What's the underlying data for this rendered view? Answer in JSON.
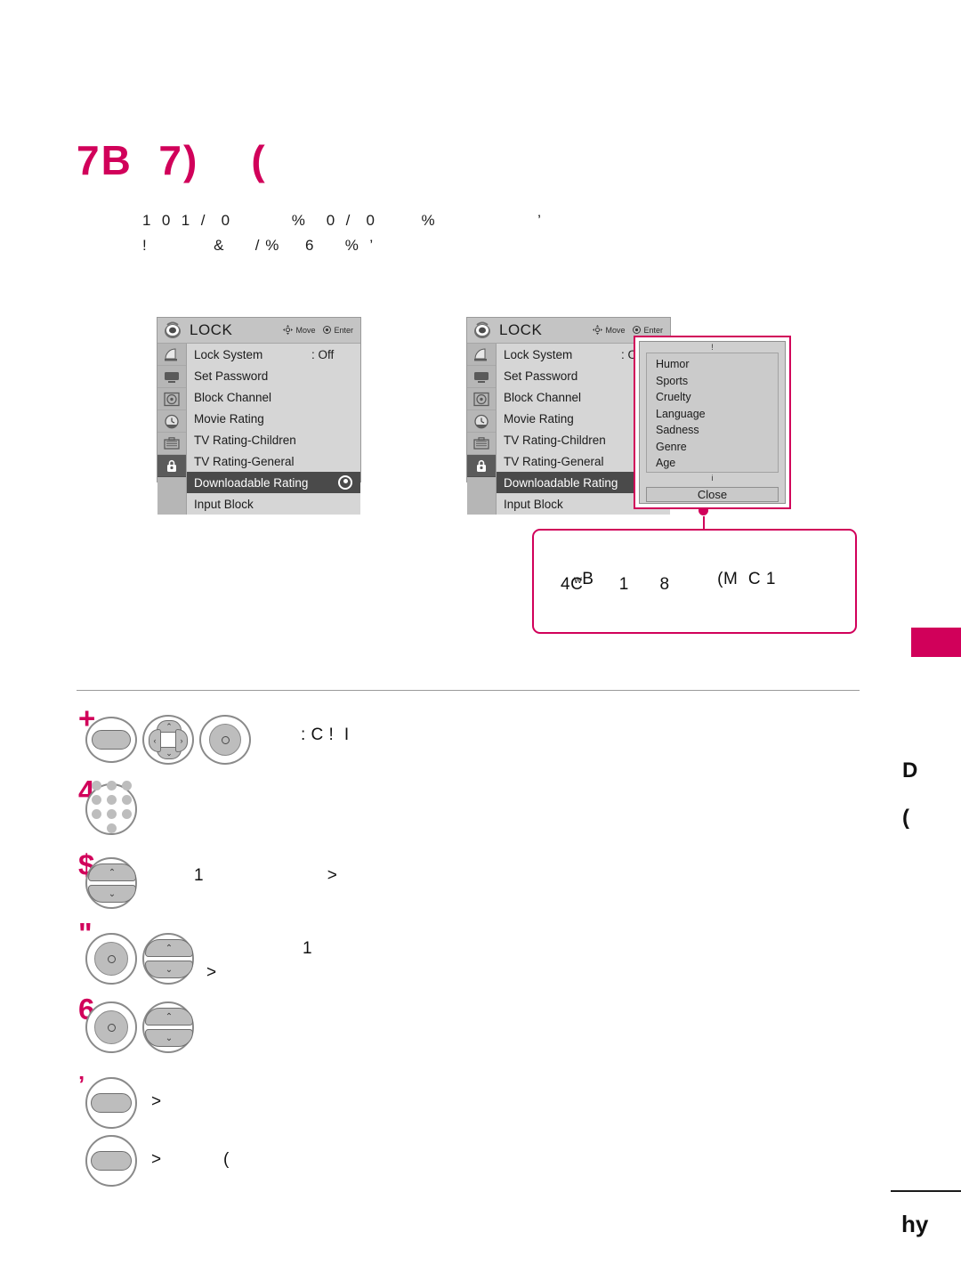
{
  "page": {
    "title": "7B  7)    (",
    "intro_line_1": "1  0  1  /   0            %    0  /   0         %                    ’",
    "intro_line_2": "!             &      / %     6      %  ’",
    "footer_number": "hy",
    "side_margin_glyph_1": "D",
    "side_margin_glyph_2": "(",
    "accent_color": "#d1005a"
  },
  "osd_menu": {
    "header": {
      "title": "LOCK",
      "icon": "lock-menu-icon",
      "hints": [
        {
          "label": "Move",
          "icon": "dpad-icon"
        },
        {
          "label": "Enter",
          "icon": "enter-icon"
        }
      ]
    },
    "rail_icons": [
      "satellite-dish-icon",
      "tv-monitor-icon",
      "audio-disc-icon",
      "clock-icon",
      "setup-case-icon",
      "lock-icon"
    ],
    "rows": [
      {
        "label": "Lock System",
        "value": ": Off",
        "selected": false,
        "indicator": false
      },
      {
        "label": "Set Password",
        "value": "",
        "selected": false,
        "indicator": false
      },
      {
        "label": "Block Channel",
        "value": "",
        "selected": false,
        "indicator": false
      },
      {
        "label": "Movie Rating",
        "value": "",
        "selected": false,
        "indicator": false
      },
      {
        "label": "TV Rating-Children",
        "value": "",
        "selected": false,
        "indicator": false
      },
      {
        "label": "TV Rating-General",
        "value": "",
        "selected": false,
        "indicator": false
      },
      {
        "label": "Downloadable Rating",
        "value": "",
        "selected": true,
        "indicator": true
      },
      {
        "label": "Input Block",
        "value": "",
        "selected": false,
        "indicator": false
      }
    ]
  },
  "popup": {
    "caption_top": "!",
    "caption_bottom": "i",
    "items": [
      "Humor",
      "Sports",
      "Cruelty",
      "Language",
      "Sadness",
      "Genre",
      "Age"
    ],
    "close_label": "Close"
  },
  "callout": {
    "line_1_small": "w",
    "line_1": "B                        (M  C 1",
    "line_2": "4C       1      8"
  },
  "steps": [
    {
      "number": "+",
      "text": ": C !  I",
      "buttons": [
        "menu-button",
        "dpad-button",
        "ok-button"
      ]
    },
    {
      "number": "4",
      "text": "",
      "buttons": [
        "number-keypad-button"
      ]
    },
    {
      "number": "$",
      "text": "1                        >",
      "buttons": [
        "updown-button"
      ]
    },
    {
      "number": "\"",
      "text_a": "1",
      "text_b": ">",
      "buttons": [
        "ok-button",
        "updown-button"
      ]
    },
    {
      "number": "6",
      "text": "",
      "buttons": [
        "ok-button",
        "updown-button"
      ]
    },
    {
      "number": "’",
      "text": ">",
      "buttons": [
        "menu-button"
      ]
    },
    {
      "number": "",
      "text": ">            (",
      "buttons": [
        "exit-button"
      ]
    }
  ]
}
